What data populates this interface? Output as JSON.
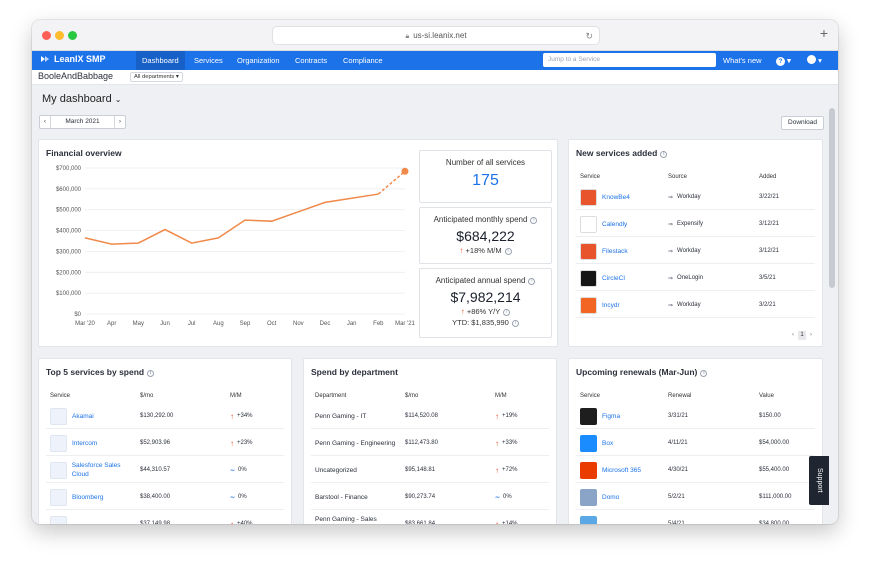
{
  "browser": {
    "url": "us-si.leanix.net"
  },
  "nav": {
    "brand": "LeanIX SMP",
    "items": [
      "Dashboard",
      "Services",
      "Organization",
      "Contracts",
      "Compliance"
    ],
    "search_placeholder": "Jump to a Service",
    "whats_new": "What's new",
    "help": "?"
  },
  "subbar": {
    "org": "BooleAndBabbage",
    "department": "All departments"
  },
  "page": {
    "title": "My dashboard",
    "month": "March 2021",
    "download": "Download",
    "support": "Support"
  },
  "financial": {
    "title": "Financial overview",
    "chart_data": {
      "type": "line",
      "x": [
        "Mar '20",
        "Apr",
        "May",
        "Jun",
        "Jul",
        "Aug",
        "Sep",
        "Oct",
        "Nov",
        "Dec",
        "Jan",
        "Feb",
        "Mar '21"
      ],
      "y_ticks": [
        "$700,000",
        "$600,000",
        "$500,000",
        "$400,000",
        "$300,000",
        "$200,000",
        "$100,000",
        "$0"
      ],
      "ylim": [
        0,
        700000
      ],
      "series": [
        {
          "values": [
            365000,
            335000,
            340000,
            405000,
            340000,
            365000,
            450000,
            445000,
            490000,
            535000,
            555000,
            575000,
            684222
          ]
        }
      ],
      "projected_from_index": 11,
      "color": "#f08a4b"
    }
  },
  "stats": {
    "services": {
      "label": "Number of all services",
      "value": "175"
    },
    "monthly": {
      "label": "Anticipated monthly spend",
      "value": "$684,222",
      "change": "+18% M/M"
    },
    "annual": {
      "label": "Anticipated annual spend",
      "value": "$7,982,214",
      "change": "+86% Y/Y",
      "ytd": "YTD: $1,835,990"
    }
  },
  "new_services": {
    "title": "New services added",
    "headers": [
      "Service",
      "Source",
      "Added"
    ],
    "rows": [
      {
        "name": "KnowBe4",
        "source": "Workday",
        "added": "3/22/21",
        "color": "#e8542c"
      },
      {
        "name": "Calendly",
        "source": "Expensify",
        "added": "3/12/21",
        "color": "#ffffff"
      },
      {
        "name": "Filestack",
        "source": "Workday",
        "added": "3/12/21",
        "color": "#e8542c"
      },
      {
        "name": "CircleCI",
        "source": "OneLogin",
        "added": "3/5/21",
        "color": "#161616"
      },
      {
        "name": "Incydr",
        "source": "Workday",
        "added": "3/2/21",
        "color": "#f26522"
      }
    ],
    "page": "1"
  },
  "top5": {
    "title": "Top 5 services by spend",
    "headers": [
      "Service",
      "$/mo",
      "M/M"
    ],
    "rows": [
      {
        "name": "Akamai",
        "spend": "$130,292.00",
        "mm": "+34%",
        "dir": "up"
      },
      {
        "name": "Intercom",
        "spend": "$52,903.96",
        "mm": "+23%",
        "dir": "up"
      },
      {
        "name": "Salesforce Sales Cloud",
        "spend": "$44,310.57",
        "mm": "0%",
        "dir": "flat"
      },
      {
        "name": "Bloomberg",
        "spend": "$38,400.00",
        "mm": "0%",
        "dir": "flat"
      },
      {
        "name": "",
        "spend": "$37,149.98",
        "mm": "+40%",
        "dir": "up"
      }
    ]
  },
  "department": {
    "title": "Spend by department",
    "headers": [
      "Department",
      "$/mo",
      "M/M"
    ],
    "rows": [
      {
        "name": "Penn Gaming - IT",
        "spend": "$114,520.08",
        "mm": "+19%",
        "dir": "up"
      },
      {
        "name": "Penn Gaming - Engineering",
        "spend": "$112,473.80",
        "mm": "+33%",
        "dir": "up"
      },
      {
        "name": "Uncategorized",
        "spend": "$95,148.81",
        "mm": "+72%",
        "dir": "up"
      },
      {
        "name": "Barstool - Finance",
        "spend": "$90,273.74",
        "mm": "0%",
        "dir": "flat"
      },
      {
        "name": "Penn Gaming - Sales Operations",
        "spend": "$83,661.84",
        "mm": "+14%",
        "dir": "up"
      }
    ]
  },
  "renewals": {
    "title": "Upcoming renewals (Mar-Jun)",
    "headers": [
      "Service",
      "Renewal",
      "Value"
    ],
    "rows": [
      {
        "name": "Figma",
        "renewal": "3/31/21",
        "value": "$150.00",
        "color": "#1e1e1e"
      },
      {
        "name": "Box",
        "renewal": "4/11/21",
        "value": "$54,000.00",
        "color": "#1a8cff"
      },
      {
        "name": "Microsoft 365",
        "renewal": "4/30/21",
        "value": "$55,400.00",
        "color": "#eb3c00"
      },
      {
        "name": "Domo",
        "renewal": "5/2/21",
        "value": "$111,000.00",
        "color": "#8aa4c7"
      },
      {
        "name": "",
        "renewal": "5/4/21",
        "value": "$34,800.00",
        "color": "#5aa9e6"
      }
    ]
  }
}
